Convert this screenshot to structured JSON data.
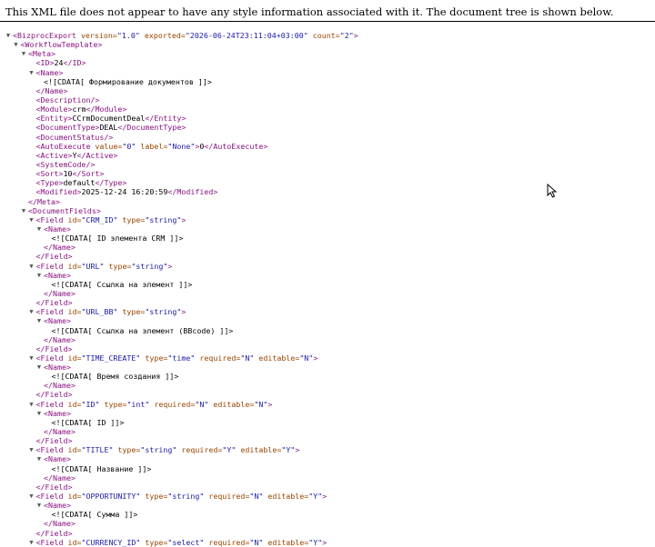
{
  "banner": {
    "message": "This XML file does not appear to have any style information associated with it. The document tree is shown below."
  },
  "lines": [
    {
      "d": 0,
      "t": true,
      "s": [
        [
          "t",
          "<BizprocExport "
        ],
        [
          "a",
          "version="
        ],
        [
          "v",
          "\"1.0\""
        ],
        [
          "t",
          " "
        ],
        [
          "a",
          "exported="
        ],
        [
          "v",
          "\"2026-06-24T23:11:04+03:00\""
        ],
        [
          "t",
          " "
        ],
        [
          "a",
          "count="
        ],
        [
          "v",
          "\"2\""
        ],
        [
          "t",
          ">"
        ]
      ]
    },
    {
      "d": 1,
      "t": true,
      "s": [
        [
          "t",
          "<WorkflowTemplate>"
        ]
      ]
    },
    {
      "d": 2,
      "t": true,
      "s": [
        [
          "t",
          "<Meta>"
        ]
      ]
    },
    {
      "d": 3,
      "t": false,
      "s": [
        [
          "t",
          "<ID>"
        ],
        [
          "x",
          "24"
        ],
        [
          "t",
          "</ID>"
        ]
      ]
    },
    {
      "d": 3,
      "t": true,
      "s": [
        [
          "t",
          "<Name>"
        ]
      ]
    },
    {
      "d": 4,
      "t": false,
      "s": [
        [
          "x",
          "<![CDATA[ Формирование документов ]]>"
        ]
      ]
    },
    {
      "d": 3,
      "t": false,
      "s": [
        [
          "t",
          "</Name>"
        ]
      ]
    },
    {
      "d": 3,
      "t": false,
      "s": [
        [
          "t",
          "<Description/>"
        ]
      ]
    },
    {
      "d": 3,
      "t": false,
      "s": [
        [
          "t",
          "<Module>"
        ],
        [
          "x",
          "crm"
        ],
        [
          "t",
          "</Module>"
        ]
      ]
    },
    {
      "d": 3,
      "t": false,
      "s": [
        [
          "t",
          "<Entity>"
        ],
        [
          "x",
          "CCrmDocumentDeal"
        ],
        [
          "t",
          "</Entity>"
        ]
      ]
    },
    {
      "d": 3,
      "t": false,
      "s": [
        [
          "t",
          "<DocumentType>"
        ],
        [
          "x",
          "DEAL"
        ],
        [
          "t",
          "</DocumentType>"
        ]
      ]
    },
    {
      "d": 3,
      "t": false,
      "s": [
        [
          "t",
          "<DocumentStatus/>"
        ]
      ]
    },
    {
      "d": 3,
      "t": false,
      "s": [
        [
          "t",
          "<AutoExecute "
        ],
        [
          "a",
          "value="
        ],
        [
          "v",
          "\"0\""
        ],
        [
          "t",
          " "
        ],
        [
          "a",
          "label="
        ],
        [
          "v",
          "\"None\""
        ],
        [
          "t",
          ">"
        ],
        [
          "x",
          "0"
        ],
        [
          "t",
          "</AutoExecute>"
        ]
      ]
    },
    {
      "d": 3,
      "t": false,
      "s": [
        [
          "t",
          "<Active>"
        ],
        [
          "x",
          "Y"
        ],
        [
          "t",
          "</Active>"
        ]
      ]
    },
    {
      "d": 3,
      "t": false,
      "s": [
        [
          "t",
          "<SystemCode/>"
        ]
      ]
    },
    {
      "d": 3,
      "t": false,
      "s": [
        [
          "t",
          "<Sort>"
        ],
        [
          "x",
          "10"
        ],
        [
          "t",
          "</Sort>"
        ]
      ]
    },
    {
      "d": 3,
      "t": false,
      "s": [
        [
          "t",
          "<Type>"
        ],
        [
          "x",
          "default"
        ],
        [
          "t",
          "</Type>"
        ]
      ]
    },
    {
      "d": 3,
      "t": false,
      "s": [
        [
          "t",
          "<Modified>"
        ],
        [
          "x",
          "2025-12-24 16:20:59"
        ],
        [
          "t",
          "</Modified>"
        ]
      ]
    },
    {
      "d": 2,
      "t": false,
      "s": [
        [
          "t",
          "</Meta>"
        ]
      ]
    },
    {
      "d": 2,
      "t": true,
      "s": [
        [
          "t",
          "<DocumentFields>"
        ]
      ]
    },
    {
      "d": 3,
      "t": true,
      "s": [
        [
          "t",
          "<Field "
        ],
        [
          "a",
          "id="
        ],
        [
          "v",
          "\"CRM_ID\""
        ],
        [
          "t",
          " "
        ],
        [
          "a",
          "type="
        ],
        [
          "v",
          "\"string\""
        ],
        [
          "t",
          ">"
        ]
      ]
    },
    {
      "d": 4,
      "t": true,
      "s": [
        [
          "t",
          "<Name>"
        ]
      ]
    },
    {
      "d": 5,
      "t": false,
      "s": [
        [
          "x",
          "<![CDATA[ ID элемента CRM ]]>"
        ]
      ]
    },
    {
      "d": 4,
      "t": false,
      "s": [
        [
          "t",
          "</Name>"
        ]
      ]
    },
    {
      "d": 3,
      "t": false,
      "s": [
        [
          "t",
          "</Field>"
        ]
      ]
    },
    {
      "d": 3,
      "t": true,
      "s": [
        [
          "t",
          "<Field "
        ],
        [
          "a",
          "id="
        ],
        [
          "v",
          "\"URL\""
        ],
        [
          "t",
          " "
        ],
        [
          "a",
          "type="
        ],
        [
          "v",
          "\"string\""
        ],
        [
          "t",
          ">"
        ]
      ]
    },
    {
      "d": 4,
      "t": true,
      "s": [
        [
          "t",
          "<Name>"
        ]
      ]
    },
    {
      "d": 5,
      "t": false,
      "s": [
        [
          "x",
          "<![CDATA[ Ссылка на элемент ]]>"
        ]
      ]
    },
    {
      "d": 4,
      "t": false,
      "s": [
        [
          "t",
          "</Name>"
        ]
      ]
    },
    {
      "d": 3,
      "t": false,
      "s": [
        [
          "t",
          "</Field>"
        ]
      ]
    },
    {
      "d": 3,
      "t": true,
      "s": [
        [
          "t",
          "<Field "
        ],
        [
          "a",
          "id="
        ],
        [
          "v",
          "\"URL_BB\""
        ],
        [
          "t",
          " "
        ],
        [
          "a",
          "type="
        ],
        [
          "v",
          "\"string\""
        ],
        [
          "t",
          ">"
        ]
      ]
    },
    {
      "d": 4,
      "t": true,
      "s": [
        [
          "t",
          "<Name>"
        ]
      ]
    },
    {
      "d": 5,
      "t": false,
      "s": [
        [
          "x",
          "<![CDATA[ Ссылка на элемент (BBcode) ]]>"
        ]
      ]
    },
    {
      "d": 4,
      "t": false,
      "s": [
        [
          "t",
          "</Name>"
        ]
      ]
    },
    {
      "d": 3,
      "t": false,
      "s": [
        [
          "t",
          "</Field>"
        ]
      ]
    },
    {
      "d": 3,
      "t": true,
      "s": [
        [
          "t",
          "<Field "
        ],
        [
          "a",
          "id="
        ],
        [
          "v",
          "\"TIME_CREATE\""
        ],
        [
          "t",
          " "
        ],
        [
          "a",
          "type="
        ],
        [
          "v",
          "\"time\""
        ],
        [
          "t",
          " "
        ],
        [
          "a",
          "required="
        ],
        [
          "v",
          "\"N\""
        ],
        [
          "t",
          " "
        ],
        [
          "a",
          "editable="
        ],
        [
          "v",
          "\"N\""
        ],
        [
          "t",
          ">"
        ]
      ]
    },
    {
      "d": 4,
      "t": true,
      "s": [
        [
          "t",
          "<Name>"
        ]
      ]
    },
    {
      "d": 5,
      "t": false,
      "s": [
        [
          "x",
          "<![CDATA[ Время создания ]]>"
        ]
      ]
    },
    {
      "d": 4,
      "t": false,
      "s": [
        [
          "t",
          "</Name>"
        ]
      ]
    },
    {
      "d": 3,
      "t": false,
      "s": [
        [
          "t",
          "</Field>"
        ]
      ]
    },
    {
      "d": 3,
      "t": true,
      "s": [
        [
          "t",
          "<Field "
        ],
        [
          "a",
          "id="
        ],
        [
          "v",
          "\"ID\""
        ],
        [
          "t",
          " "
        ],
        [
          "a",
          "type="
        ],
        [
          "v",
          "\"int\""
        ],
        [
          "t",
          " "
        ],
        [
          "a",
          "required="
        ],
        [
          "v",
          "\"N\""
        ],
        [
          "t",
          " "
        ],
        [
          "a",
          "editable="
        ],
        [
          "v",
          "\"N\""
        ],
        [
          "t",
          ">"
        ]
      ]
    },
    {
      "d": 4,
      "t": true,
      "s": [
        [
          "t",
          "<Name>"
        ]
      ]
    },
    {
      "d": 5,
      "t": false,
      "s": [
        [
          "x",
          "<![CDATA[ ID ]]>"
        ]
      ]
    },
    {
      "d": 4,
      "t": false,
      "s": [
        [
          "t",
          "</Name>"
        ]
      ]
    },
    {
      "d": 3,
      "t": false,
      "s": [
        [
          "t",
          "</Field>"
        ]
      ]
    },
    {
      "d": 3,
      "t": true,
      "s": [
        [
          "t",
          "<Field "
        ],
        [
          "a",
          "id="
        ],
        [
          "v",
          "\"TITLE\""
        ],
        [
          "t",
          " "
        ],
        [
          "a",
          "type="
        ],
        [
          "v",
          "\"string\""
        ],
        [
          "t",
          " "
        ],
        [
          "a",
          "required="
        ],
        [
          "v",
          "\"Y\""
        ],
        [
          "t",
          " "
        ],
        [
          "a",
          "editable="
        ],
        [
          "v",
          "\"Y\""
        ],
        [
          "t",
          ">"
        ]
      ]
    },
    {
      "d": 4,
      "t": true,
      "s": [
        [
          "t",
          "<Name>"
        ]
      ]
    },
    {
      "d": 5,
      "t": false,
      "s": [
        [
          "x",
          "<![CDATA[ Название ]]>"
        ]
      ]
    },
    {
      "d": 4,
      "t": false,
      "s": [
        [
          "t",
          "</Name>"
        ]
      ]
    },
    {
      "d": 3,
      "t": false,
      "s": [
        [
          "t",
          "</Field>"
        ]
      ]
    },
    {
      "d": 3,
      "t": true,
      "s": [
        [
          "t",
          "<Field "
        ],
        [
          "a",
          "id="
        ],
        [
          "v",
          "\"OPPORTUNITY\""
        ],
        [
          "t",
          " "
        ],
        [
          "a",
          "type="
        ],
        [
          "v",
          "\"string\""
        ],
        [
          "t",
          " "
        ],
        [
          "a",
          "required="
        ],
        [
          "v",
          "\"N\""
        ],
        [
          "t",
          " "
        ],
        [
          "a",
          "editable="
        ],
        [
          "v",
          "\"Y\""
        ],
        [
          "t",
          ">"
        ]
      ]
    },
    {
      "d": 4,
      "t": true,
      "s": [
        [
          "t",
          "<Name>"
        ]
      ]
    },
    {
      "d": 5,
      "t": false,
      "s": [
        [
          "x",
          "<![CDATA[ Сумма ]]>"
        ]
      ]
    },
    {
      "d": 4,
      "t": false,
      "s": [
        [
          "t",
          "</Name>"
        ]
      ]
    },
    {
      "d": 3,
      "t": false,
      "s": [
        [
          "t",
          "</Field>"
        ]
      ]
    },
    {
      "d": 3,
      "t": true,
      "s": [
        [
          "t",
          "<Field "
        ],
        [
          "a",
          "id="
        ],
        [
          "v",
          "\"CURRENCY_ID\""
        ],
        [
          "t",
          " "
        ],
        [
          "a",
          "type="
        ],
        [
          "v",
          "\"select\""
        ],
        [
          "t",
          " "
        ],
        [
          "a",
          "required="
        ],
        [
          "v",
          "\"N\""
        ],
        [
          "t",
          " "
        ],
        [
          "a",
          "editable="
        ],
        [
          "v",
          "\"Y\""
        ],
        [
          "t",
          ">"
        ]
      ]
    }
  ]
}
